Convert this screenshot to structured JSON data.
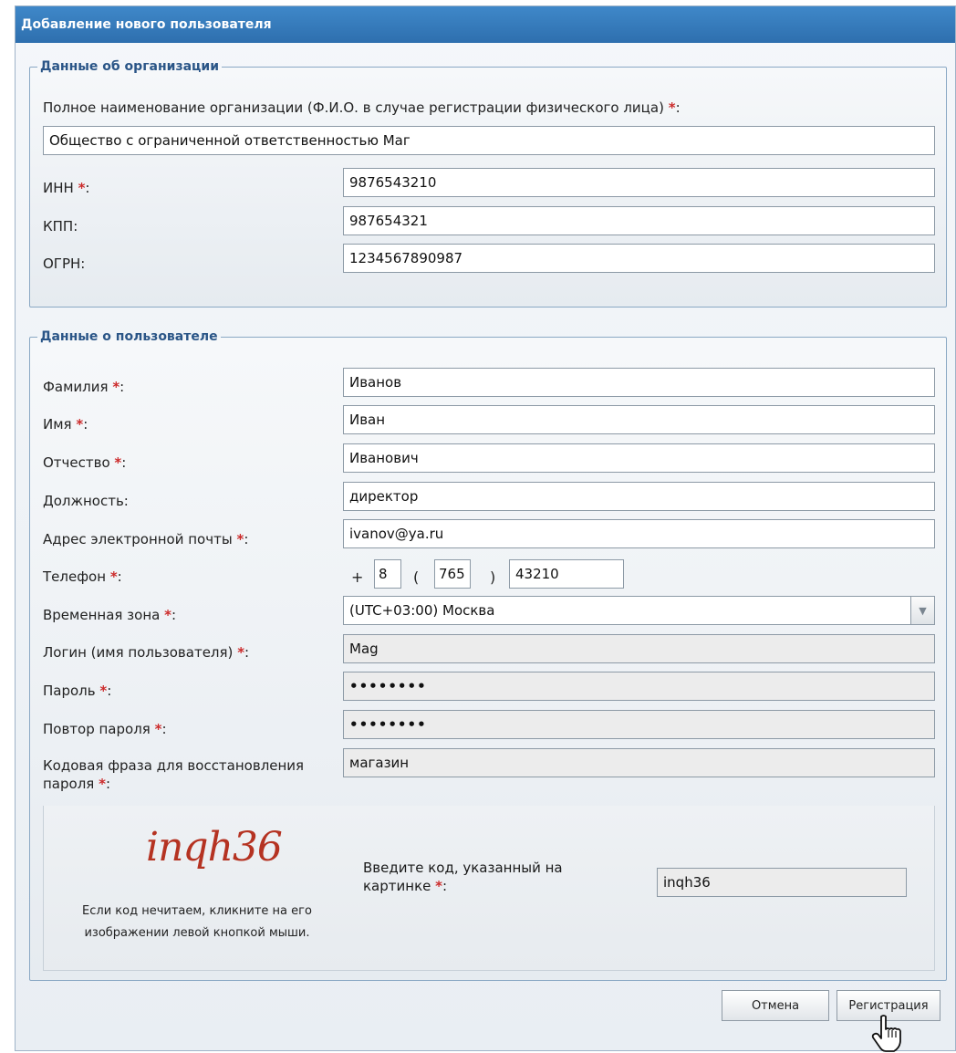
{
  "window": {
    "title": "Добавление нового пользователя"
  },
  "org": {
    "legend": "Данные об организации",
    "fullname_label": "Полное наименование организации (Ф.И.О. в случае регистрации физического лица)",
    "fullname_value": "Общество с ограниченной ответственностью Маг",
    "inn_label": "ИНН",
    "inn_value": "9876543210",
    "kpp_label": "КПП:",
    "kpp_value": "987654321",
    "ogrn_label": "ОГРН:",
    "ogrn_value": "1234567890987"
  },
  "user": {
    "legend": "Данные о пользователе",
    "lastname_label": "Фамилия",
    "lastname_value": "Иванов",
    "firstname_label": "Имя",
    "firstname_value": "Иван",
    "middlename_label": "Отчество",
    "middlename_value": "Иванович",
    "position_label": "Должность:",
    "position_value": "директор",
    "email_label": "Адрес электронной почты",
    "email_value": "ivanov@ya.ru",
    "phone_label": "Телефон",
    "phone_country": "8",
    "phone_area": "765",
    "phone_number": "43210",
    "timezone_label": "Временная зона",
    "timezone_value": "(UTC+03:00) Москва",
    "login_label": "Логин (имя пользователя)",
    "login_value": "Mag",
    "password_label": "Пароль",
    "password_value": "••••••••",
    "password_repeat_label": "Повтор пароля",
    "password_repeat_value": "••••••••",
    "phrase_label_line1": "Кодовая фраза для восстановления",
    "phrase_label_line2": "пароля",
    "phrase_value": "магазин"
  },
  "captcha": {
    "image_text": "inqh36",
    "note_line1": "Если код нечитаем, кликните на его",
    "note_line2": "изображении левой кнопкой мыши.",
    "prompt_line1": "Введите код, указанный на",
    "prompt_line2": "картинке",
    "input_value": "inqh36"
  },
  "phone_symbols": {
    "plus": "+",
    "open": "(",
    "close": ")"
  },
  "required_mark": "*",
  "buttons": {
    "cancel": "Отмена",
    "register": "Регистрация"
  },
  "colors": {
    "title_bar": "#3478bb",
    "legend": "#2a5587",
    "required": "#cc2b2b"
  }
}
